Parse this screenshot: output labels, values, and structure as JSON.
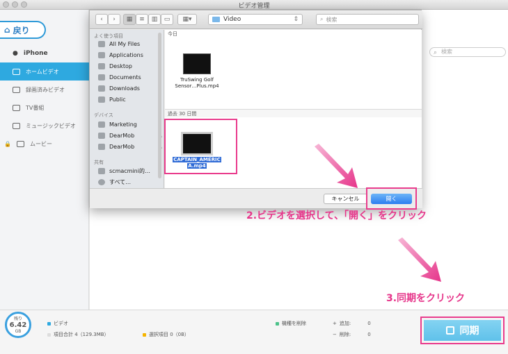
{
  "window": {
    "title": "ビデオ管理"
  },
  "sidebar": {
    "back_label": "戻り",
    "device": "iPhone",
    "items": [
      {
        "label": "ホームビデオ"
      },
      {
        "label": "録画済みビデオ"
      },
      {
        "label": "TV番組"
      },
      {
        "label": "ミュージックビデオ"
      },
      {
        "label": "ムービー"
      }
    ]
  },
  "main": {
    "search_placeholder": "検索"
  },
  "dialog": {
    "path": "Video",
    "search_placeholder": "検索",
    "sidebar": {
      "favorites_header": "よく使う項目",
      "favorites": [
        "All My Files",
        "Applications",
        "Desktop",
        "Documents",
        "Downloads",
        "Public"
      ],
      "devices_header": "デバイス",
      "devices": [
        "Marketing",
        "DearMob",
        "DearMob"
      ],
      "shared_header": "共有",
      "shared": [
        "scmacmini的…",
        "すべて…"
      ]
    },
    "files": {
      "today_header": "今日",
      "today_file": {
        "line1": "TruSwing Golf",
        "line2": "Sensor…Plus.mp4"
      },
      "past_header": "過去 30 日間",
      "selected_file": {
        "line1": "CAPTAIN_AMERIC",
        "line2": "A.mp4"
      }
    },
    "cancel_label": "キャンセル",
    "open_label": "開く"
  },
  "footer": {
    "storage": {
      "label": "残り",
      "value": "6.42",
      "unit": "GB"
    },
    "video_label": "ビデオ",
    "total_label": "項目合計 4（129.3MB）",
    "selected_label": "選択項目 0（0B）",
    "new_label": "機種を削除",
    "add_label": "追加:",
    "add_count": "0",
    "del_label": "削除:",
    "del_count": "0",
    "sync_label": "同期"
  },
  "annotations": {
    "step2": "2.ビデオを選択して、「開く」をクリック",
    "step3": "3.同期をクリック"
  },
  "colors": {
    "accent": "#2ea9e0",
    "highlight": "#e93b8c",
    "selection": "#2f6bd6"
  }
}
